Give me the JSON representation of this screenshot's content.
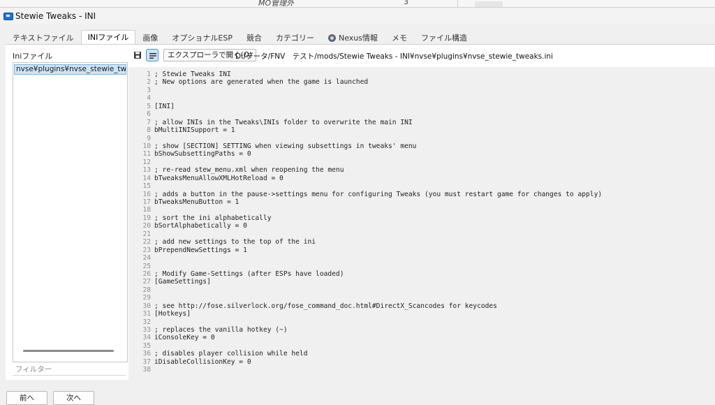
{
  "background": {
    "col1": "MO管理外",
    "col2": "3"
  },
  "window": {
    "title": "Stewie Tweaks - INI"
  },
  "tabs": [
    {
      "label": "テキストファイル",
      "active": false
    },
    {
      "label": "INIファイル",
      "active": true
    },
    {
      "label": "画像",
      "active": false
    },
    {
      "label": "オプショナルESP",
      "active": false
    },
    {
      "label": "競合",
      "active": false
    },
    {
      "label": "カテゴリー",
      "active": false
    },
    {
      "label": "Nexus情報",
      "active": false,
      "icon": "nexus-icon"
    },
    {
      "label": "メモ",
      "active": false
    },
    {
      "label": "ファイル構造",
      "active": false
    }
  ],
  "left": {
    "label": "Iniファイル",
    "files": [
      "nvse¥plugins¥nvse_stewie_tweaks.ini"
    ],
    "filter_placeholder": "フィルター"
  },
  "toolbar": {
    "save_icon": "save-icon",
    "wrap_icon": "word-wrap-icon",
    "explorer_label": "エクスプローラで開く(O)",
    "path": "D:/データ/FNV　テスト/mods/Stewie Tweaks - INI¥nvse¥plugins¥nvse_stewie_tweaks.ini"
  },
  "editor": {
    "lines": [
      "; Stewie Tweaks INI",
      "; New options are generated when the game is launched",
      "",
      "",
      "[INI]",
      "",
      "; allow INIs in the Tweaks\\INIs folder to overwrite the main INI",
      "bMultiINISupport = 1",
      "",
      "; show [SECTION] SETTING when viewing subsettings in tweaks' menu",
      "bShowSubsettingPaths = 0",
      "",
      "; re-read stew_menu.xml when reopening the menu",
      "bTweaksMenuAllowXMLHotReload = 0",
      "",
      "; adds a button in the pause->settings menu for configuring Tweaks (you must restart game for changes to apply)",
      "bTweaksMenuButton = 1",
      "",
      "; sort the ini alphabetically",
      "bSortAlphabetically = 0",
      "",
      "; add new settings to the top of the ini",
      "bPrependNewSettings = 1",
      "",
      "",
      "; Modify Game-Settings (after ESPs have loaded)",
      "[GameSettings]",
      "",
      "",
      "; see http://fose.silverlock.org/fose_command_doc.html#DirectX_Scancodes for keycodes",
      "[Hotkeys]",
      "",
      "; replaces the vanilla hotkey (~)",
      "iConsoleKey = 0",
      "",
      "; disables player collision while held",
      "iDisableCollisionKey = 0",
      ""
    ]
  },
  "footer": {
    "prev_label": "前へ",
    "next_label": "次へ"
  },
  "colors": {
    "accent": "#1e73d6",
    "selection": "#cce4f7",
    "editor_bg": "#f0f0f0"
  }
}
